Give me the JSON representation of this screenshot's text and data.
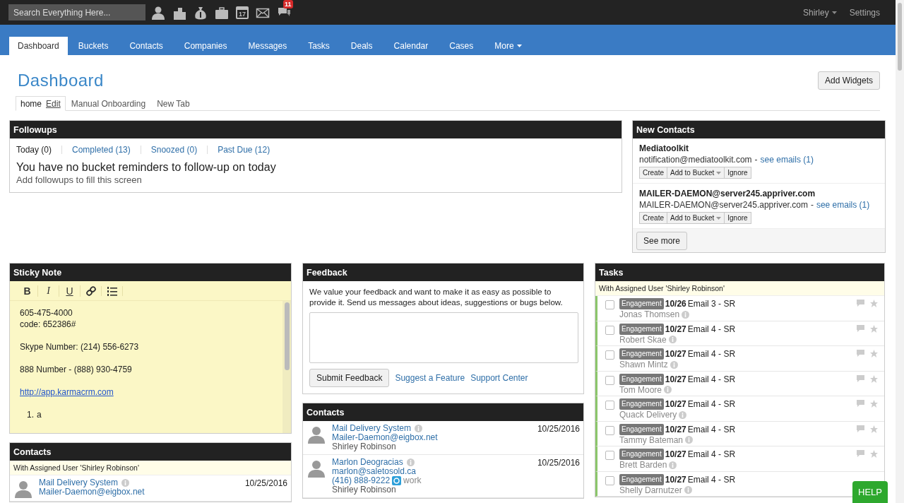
{
  "top_bar": {
    "search": {
      "placeholder": "Search Everything Here..."
    },
    "icons": [
      {
        "kind": "person"
      },
      {
        "kind": "building"
      },
      {
        "kind": "money"
      },
      {
        "kind": "briefcase"
      },
      {
        "kind": "calendar",
        "text": "17"
      },
      {
        "kind": "mail"
      },
      {
        "kind": "chat",
        "badge": "11"
      }
    ],
    "user": "Shirley",
    "settings": "Settings"
  },
  "nav_tabs": [
    {
      "label": "Dashboard",
      "selected": true
    },
    {
      "label": "Buckets",
      "selected": false
    },
    {
      "label": "Contacts",
      "selected": false
    },
    {
      "label": "Companies",
      "selected": false
    },
    {
      "label": "Messages",
      "selected": false
    },
    {
      "label": "Tasks",
      "selected": false
    },
    {
      "label": "Deals",
      "selected": false
    },
    {
      "label": "Calendar",
      "selected": false
    },
    {
      "label": "Cases",
      "selected": false
    },
    {
      "label": "More",
      "selected": false,
      "dropdown": true
    }
  ],
  "page_title": "Dashboard",
  "add_widgets": "Add Widgets",
  "dashboard_tabs": [
    {
      "label": "home",
      "edit": "Edit",
      "selected": true
    },
    {
      "label": "Manual Onboarding",
      "selected": false
    },
    {
      "label": "New Tab",
      "selected": false
    }
  ],
  "followups": {
    "title": "Followups",
    "tabs": [
      {
        "label": "Today (0)",
        "selected": true
      },
      {
        "label": "Completed (13)",
        "selected": false
      },
      {
        "label": "Snoozed (0)",
        "selected": false
      },
      {
        "label": "Past Due (12)",
        "selected": false
      }
    ],
    "message": "You have no bucket reminders to follow-up on today",
    "hint": "Add followups to fill this screen"
  },
  "new_contacts": {
    "title": "New Contacts",
    "items": [
      {
        "name": "Mediatoolkit",
        "email": "notification@mediatoolkit.com",
        "separator": "-",
        "link": "see emails (1)",
        "buttons": [
          "Create",
          "Add to Bucket",
          "Ignore"
        ]
      },
      {
        "name": "MAILER-DAEMON@server245.appriver.com",
        "email": "MAILER-DAEMON@server245.appriver.com",
        "separator": "-",
        "link": "see emails (1)",
        "buttons": [
          "Create",
          "Add to Bucket",
          "Ignore"
        ]
      }
    ],
    "more": "See more"
  },
  "sticky_note": {
    "title": "Sticky Note",
    "toolbar": [
      {
        "kind": "bold",
        "label": "B"
      },
      {
        "kind": "italic",
        "label": "I"
      },
      {
        "kind": "underline",
        "label": "U"
      },
      {
        "kind": "link"
      },
      {
        "kind": "list"
      }
    ],
    "blocks": [
      {
        "kind": "text",
        "lines": [
          "605-475-4000",
          "code: 652386#"
        ]
      },
      {
        "kind": "text",
        "lines": [
          "Skype Number: (214) 556-6273"
        ]
      },
      {
        "kind": "text",
        "lines": [
          "888 Number - (888) 930-4759"
        ]
      },
      {
        "kind": "link",
        "text": "http://app.karmacrm.com"
      },
      {
        "kind": "ordered",
        "items": [
          {
            "number": "1.",
            "text": "a"
          }
        ]
      }
    ]
  },
  "contacts_left": {
    "title": "Contacts",
    "subtitle": "With Assigned User 'Shirley Robinson'",
    "items": [
      {
        "name": "Mail Delivery System",
        "email": "Mailer-Daemon@eigbox.net",
        "date": "10/25/2016"
      }
    ]
  },
  "feedback": {
    "title": "Feedback",
    "text": "We value your feedback and want to make it as easy as possible to provide it. Send us messages about ideas, suggestions or bugs below.",
    "submit": "Submit Feedback",
    "links": [
      "Suggest a Feature",
      "Support Center"
    ]
  },
  "contacts_middle": {
    "title": "Contacts",
    "items": [
      {
        "name": "Mail Delivery System",
        "email": "Mailer-Daemon@eigbox.net",
        "owner": "Shirley Robinson",
        "date": "10/25/2016"
      },
      {
        "name": "Marlon Deogracias",
        "email": "marlon@saletosold.ca",
        "phone": "(416) 888-9222",
        "phone_type": "work",
        "owner": "Shirley Robinson",
        "date": "10/25/2016"
      }
    ]
  },
  "tasks": {
    "title": "Tasks",
    "subtitle": "With Assigned User 'Shirley Robinson'",
    "items": [
      {
        "tag": "Engagement",
        "date": "10/26",
        "title": "Email 3 - SR",
        "contact": "Jonas Thomsen",
        "checked": false,
        "actions": true
      },
      {
        "tag": "Engagement",
        "date": "10/27",
        "title": "Email 4 - SR",
        "contact": "Robert Skae",
        "checked": false,
        "actions": true
      },
      {
        "tag": "Engagement",
        "date": "10/27",
        "title": "Email 4 - SR",
        "contact": "Shawn Mintz",
        "checked": false,
        "actions": true
      },
      {
        "tag": "Engagement",
        "date": "10/27",
        "title": "Email 4 - SR",
        "contact": "Tom Moore",
        "checked": false,
        "actions": true
      },
      {
        "tag": "Engagement",
        "date": "10/27",
        "title": "Email 4 - SR",
        "contact": "Quack Delivery",
        "checked": false,
        "actions": true
      },
      {
        "tag": "Engagement",
        "date": "10/27",
        "title": "Email 4 - SR",
        "contact": "Tammy Bateman",
        "checked": false,
        "actions": true
      },
      {
        "tag": "Engagement",
        "date": "10/27",
        "title": "Email 4 - SR",
        "contact": "Brett Barden",
        "checked": false,
        "actions": true
      },
      {
        "tag": "Engagement",
        "date": "10/27",
        "title": "Email 4 - SR",
        "contact": "Shelly Darnutzer",
        "checked": false,
        "actions": false
      }
    ]
  },
  "help": "HELP"
}
